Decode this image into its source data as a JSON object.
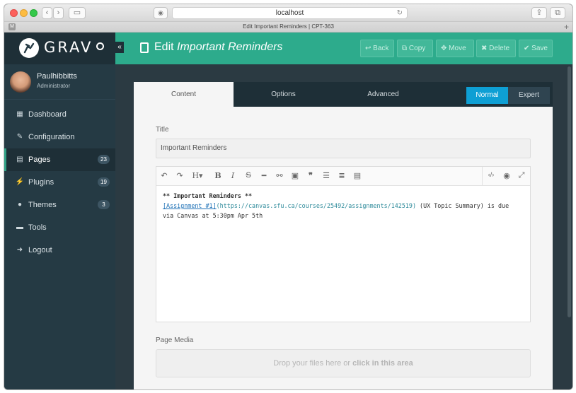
{
  "browser": {
    "address": "localhost",
    "tab_title": "Edit Important Reminders | CPT-363",
    "tab_favicon": "M"
  },
  "sidebar": {
    "logo": "GRAV",
    "user": {
      "name": "Paulhibbitts",
      "role": "Administrator"
    },
    "items": [
      {
        "label": "Dashboard",
        "icon": "grid-icon",
        "badge": ""
      },
      {
        "label": "Configuration",
        "icon": "wrench-icon",
        "badge": ""
      },
      {
        "label": "Pages",
        "icon": "file-icon",
        "badge": "23",
        "active": true
      },
      {
        "label": "Plugins",
        "icon": "plug-icon",
        "badge": "19"
      },
      {
        "label": "Themes",
        "icon": "drop-icon",
        "badge": "3"
      },
      {
        "label": "Tools",
        "icon": "briefcase-icon",
        "badge": ""
      },
      {
        "label": "Logout",
        "icon": "logout-icon",
        "badge": ""
      }
    ]
  },
  "header": {
    "title_prefix": "Edit",
    "title_name": "Important Reminders",
    "actions": {
      "back": "Back",
      "copy": "Copy",
      "move": "Move",
      "delete": "Delete",
      "save": "Save"
    }
  },
  "tabs": {
    "content": "Content",
    "options": "Options",
    "advanced": "Advanced"
  },
  "mode": {
    "normal": "Normal",
    "expert": "Expert",
    "selected": "Normal"
  },
  "form": {
    "title_label": "Title",
    "title_value": "Important Reminders",
    "content_line1": "** Important Reminders **",
    "content_link_text": "[Assignment #1]",
    "content_link_url": "(https://canvas.sfu.ca/courses/25492/assignments/142519)",
    "content_rest": " (UX Topic Summary) is due",
    "content_line3": "via Canvas at 5:30pm Apr 5th",
    "media_label": "Page Media",
    "drop_text": "Drop your files here or ",
    "drop_em": "click in this area"
  },
  "colors": {
    "accent": "#2dab8c",
    "sidebar": "#253a44",
    "toggle_on": "#0e9fd4"
  }
}
